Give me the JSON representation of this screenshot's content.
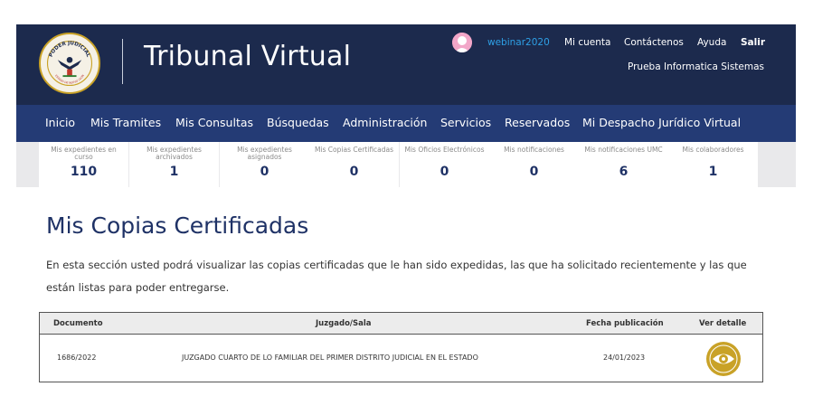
{
  "header": {
    "logo_text": "PODER JUDICIAL",
    "logo_subtext": "ESTADO DE NUEVO LEON",
    "title": "Tribunal Virtual",
    "username": "webinar2020",
    "links": [
      "Mi cuenta",
      "Contáctenos",
      "Ayuda",
      "Salir"
    ],
    "subtitle": "Prueba Informatica Sistemas"
  },
  "nav": {
    "items": [
      "Inicio",
      "Mis Tramites",
      "Mis Consultas",
      "Búsquedas",
      "Administración",
      "Servicios",
      "Reservados",
      "Mi Despacho Jurídico Virtual"
    ]
  },
  "stats": [
    {
      "label": "Mis expedientes en curso",
      "value": "110"
    },
    {
      "label": "Mis expedientes archivados",
      "value": "1"
    },
    {
      "label": "Mis expedientes asignados",
      "value": "0"
    },
    {
      "label": "Mis Copias Certificadas",
      "value": "0"
    },
    {
      "label": "Mis Oficios Electrónicos",
      "value": "0"
    },
    {
      "label": "Mis notificaciones",
      "value": "0"
    },
    {
      "label": "Mis notificaciones UMC",
      "value": "6"
    },
    {
      "label": "Mis colaboradores",
      "value": "1"
    }
  ],
  "page": {
    "title": "Mis Copias Certificadas",
    "description": "En esta sección usted podrá visualizar las copias certificadas que le han sido expedidas, las que ha solicitado recientemente y las que están listas para poder entregarse."
  },
  "table": {
    "headers": [
      "Documento",
      "Juzgado/Sala",
      "Fecha publicación",
      "Ver detalle"
    ],
    "rows": [
      {
        "documento": "1686/2022",
        "juzgado": "JUZGADO CUARTO DE LO FAMILIAR DEL PRIMER DISTRITO JUDICIAL EN EL ESTADO",
        "fecha": "24/01/2023"
      }
    ]
  },
  "colors": {
    "header_bg": "#1c2a4d",
    "nav_bg": "#243b75",
    "title_color": "#1f3266",
    "username_color": "#2ea0e6",
    "eye_icon_color": "#c9a227"
  }
}
